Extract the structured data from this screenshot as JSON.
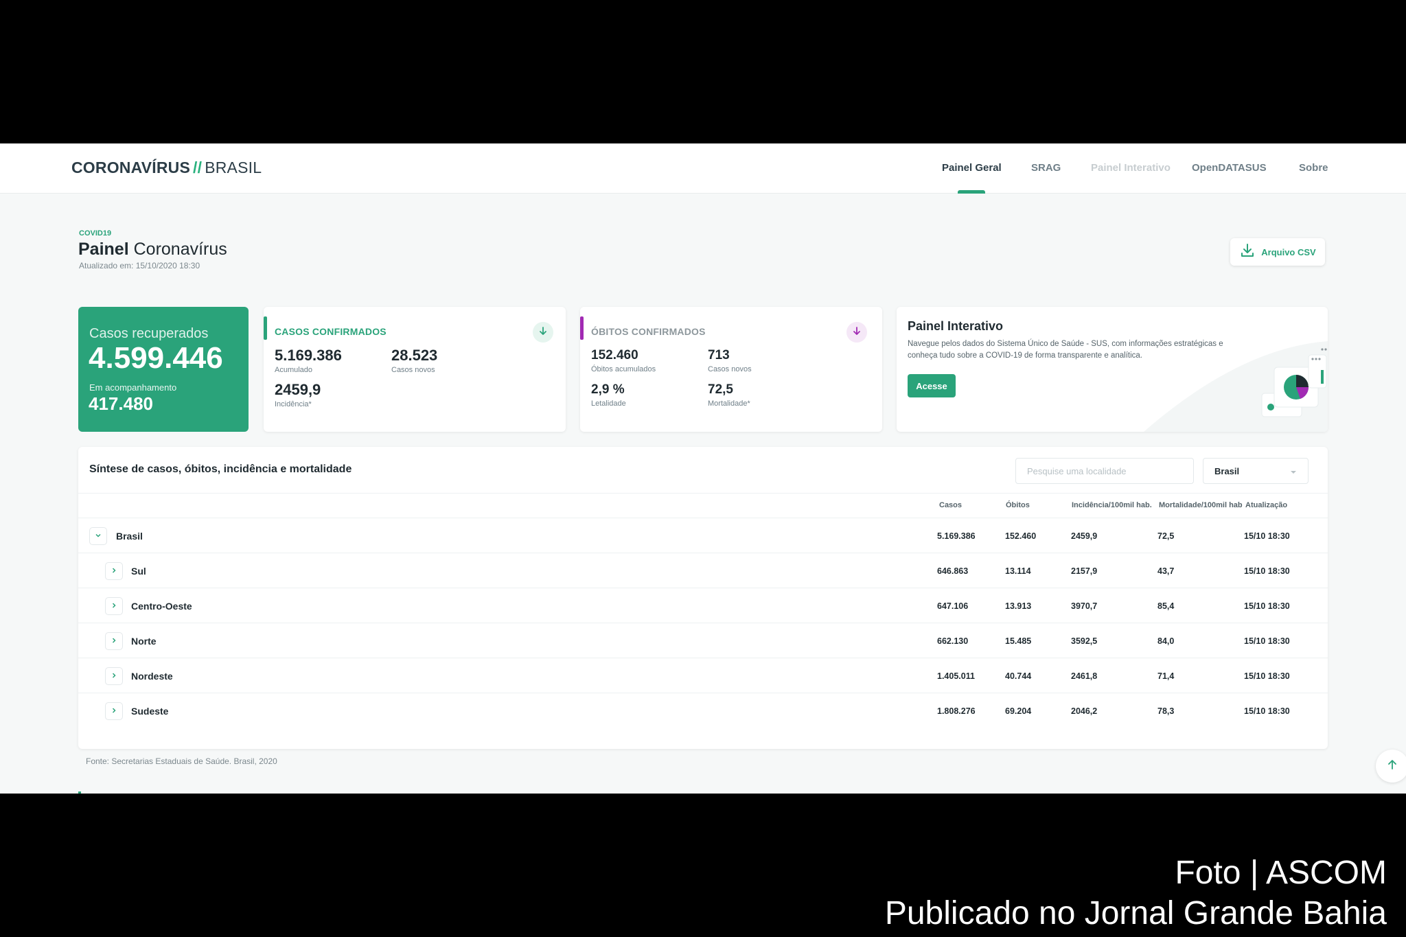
{
  "brand": {
    "bold": "CORONAVÍRUS",
    "slash": "//",
    "light": "BRASIL"
  },
  "nav": [
    "Painel Geral",
    "SRAG",
    "Painel Interativo",
    "OpenDATASUS",
    "Sobre"
  ],
  "header": {
    "eyebrow": "COVID19",
    "title_bold": "Painel",
    "title_rest": "Coronavírus",
    "updated": "Atualizado em: 15/10/2020 18:30",
    "csv_label": "Arquivo CSV"
  },
  "recovered": {
    "label": "Casos recuperados",
    "value": "4.599.446",
    "sub_label": "Em acompanhamento",
    "sub_value": "417.480"
  },
  "cases": {
    "title": "CASOS CONFIRMADOS",
    "acc_value": "5.169.386",
    "acc_label": "Acumulado",
    "new_value": "28.523",
    "new_label": "Casos novos",
    "inc_value": "2459,9",
    "inc_label": "Incidência*"
  },
  "deaths": {
    "title": "ÓBITOS CONFIRMADOS",
    "acc_value": "152.460",
    "acc_label": "Óbitos acumulados",
    "new_value": "713",
    "new_label": "Casos novos",
    "let_value": "2,9 %",
    "let_label": "Letalidade",
    "mort_value": "72,5",
    "mort_label": "Mortalidade*"
  },
  "interactive": {
    "title": "Painel Interativo",
    "desc": "Navegue pelos dados do Sistema Único de Saúde - SUS, com informações estratégicas e conheça tudo sobre a COVID-19 de forma transparente e analítica.",
    "button": "Acesse"
  },
  "table": {
    "title": "Síntese de casos, óbitos, incidência e mortalidade",
    "search_placeholder": "Pesquise uma localidade",
    "select_value": "Brasil",
    "columns": [
      "Casos",
      "Óbitos",
      "Incidência/100mil hab.",
      "Mortalidade/100mil hab",
      "Atualização"
    ],
    "rows": [
      {
        "name": "Brasil",
        "cases": "5.169.386",
        "deaths": "152.460",
        "incidence": "2459,9",
        "mortality": "72,5",
        "updated": "15/10 18:30"
      },
      {
        "name": "Sul",
        "cases": "646.863",
        "deaths": "13.114",
        "incidence": "2157,9",
        "mortality": "43,7",
        "updated": "15/10 18:30"
      },
      {
        "name": "Centro-Oeste",
        "cases": "647.106",
        "deaths": "13.913",
        "incidence": "3970,7",
        "mortality": "85,4",
        "updated": "15/10 18:30"
      },
      {
        "name": "Norte",
        "cases": "662.130",
        "deaths": "15.485",
        "incidence": "3592,5",
        "mortality": "84,0",
        "updated": "15/10 18:30"
      },
      {
        "name": "Nordeste",
        "cases": "1.405.011",
        "deaths": "40.744",
        "incidence": "2461,8",
        "mortality": "71,4",
        "updated": "15/10 18:30"
      },
      {
        "name": "Sudeste",
        "cases": "1.808.276",
        "deaths": "69.204",
        "incidence": "2046,2",
        "mortality": "78,3",
        "updated": "15/10 18:30"
      }
    ]
  },
  "source": "Fonte: Secretarias Estaduais de Saúde. Brasil, 2020",
  "caption": {
    "line1": "Foto | ASCOM",
    "line2": "Publicado no Jornal Grande Bahia"
  },
  "colors": {
    "accent": "#2aa37a",
    "deaths_accent": "#a12ab3",
    "text": "#1f2a30"
  },
  "icons": {
    "csv": "download-icon",
    "cases": "arrow-down-icon",
    "deaths": "arrow-down-icon",
    "scroll": "arrow-up-icon",
    "row_expanded": "chevron-down-icon",
    "row_collapsed": "chevron-right-icon",
    "select": "caret-down-icon"
  }
}
